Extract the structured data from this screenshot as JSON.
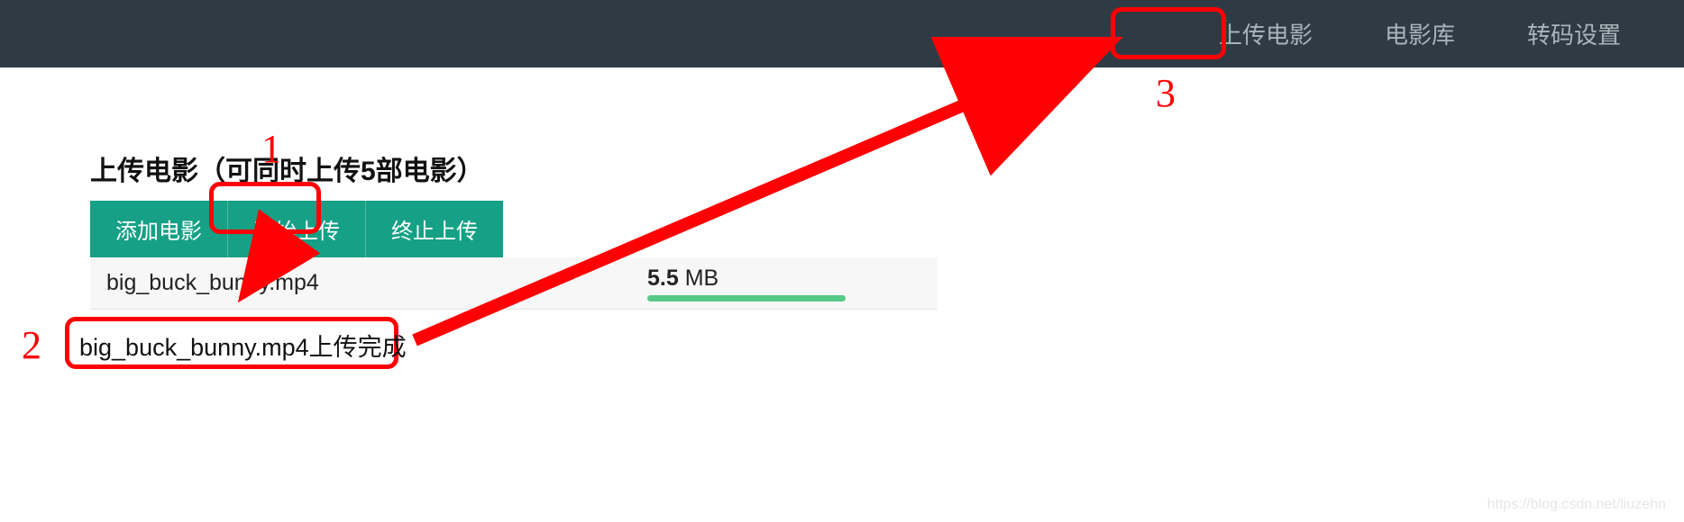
{
  "nav": {
    "upload": "上传电影",
    "library": "电影库",
    "transcode": "转码设置"
  },
  "page": {
    "title": "上传电影（可同时上传5部电影）"
  },
  "buttons": {
    "add": "添加电影",
    "start": "开始上传",
    "stop": "终止上传"
  },
  "file": {
    "name": "big_buck_bunny.mp4",
    "size_value": "5.5",
    "size_unit": " MB"
  },
  "annotations": {
    "n1": "1",
    "n2": "2",
    "n3": "3",
    "status_text": "big_buck_bunny.mp4上传完成"
  },
  "watermark": "https://blog.csdn.net/liuzehn"
}
